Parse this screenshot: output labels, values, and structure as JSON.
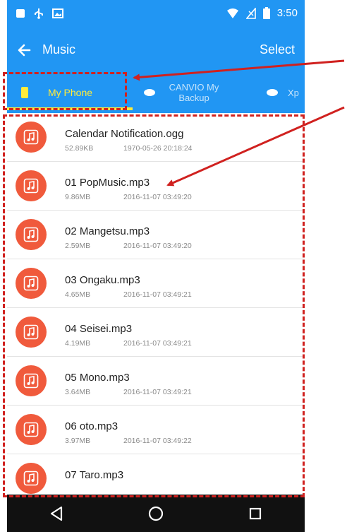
{
  "status_bar": {
    "time": "3:50"
  },
  "toolbar": {
    "title": "Music",
    "select_label": "Select"
  },
  "tabs": [
    {
      "label": "My Phone",
      "active": true
    },
    {
      "label": "CANVIO My Backup",
      "active": false
    },
    {
      "label": "Xp",
      "active": false
    }
  ],
  "files": [
    {
      "name": "Calendar Notification.ogg",
      "size": "52.89KB",
      "date": "1970-05-26 20:18:24"
    },
    {
      "name": "01 PopMusic.mp3",
      "size": "9.86MB",
      "date": "2016-11-07 03:49:20"
    },
    {
      "name": "02 Mangetsu.mp3",
      "size": "2.59MB",
      "date": "2016-11-07 03:49:20"
    },
    {
      "name": "03 Ongaku.mp3",
      "size": "4.65MB",
      "date": "2016-11-07 03:49:21"
    },
    {
      "name": "04 Seisei.mp3",
      "size": "4.19MB",
      "date": "2016-11-07 03:49:21"
    },
    {
      "name": "05 Mono.mp3",
      "size": "3.64MB",
      "date": "2016-11-07 03:49:21"
    },
    {
      "name": "06 oto.mp3",
      "size": "3.97MB",
      "date": "2016-11-07 03:49:22"
    },
    {
      "name": "07 Taro.mp3",
      "size": "",
      "date": ""
    }
  ],
  "colors": {
    "primary": "#2196f3",
    "accent_tab": "#ffeb3b",
    "file_avatar": "#f05a3c",
    "annotation": "#d0211f",
    "nav_bar": "#111111"
  },
  "icons": {
    "status": [
      "notification-icon",
      "usb-icon",
      "image-icon",
      "wifi-icon",
      "signal-icon",
      "battery-icon"
    ],
    "file": "music-note-icon",
    "nav": [
      "back-triangle-icon",
      "home-circle-icon",
      "recents-square-icon"
    ]
  }
}
